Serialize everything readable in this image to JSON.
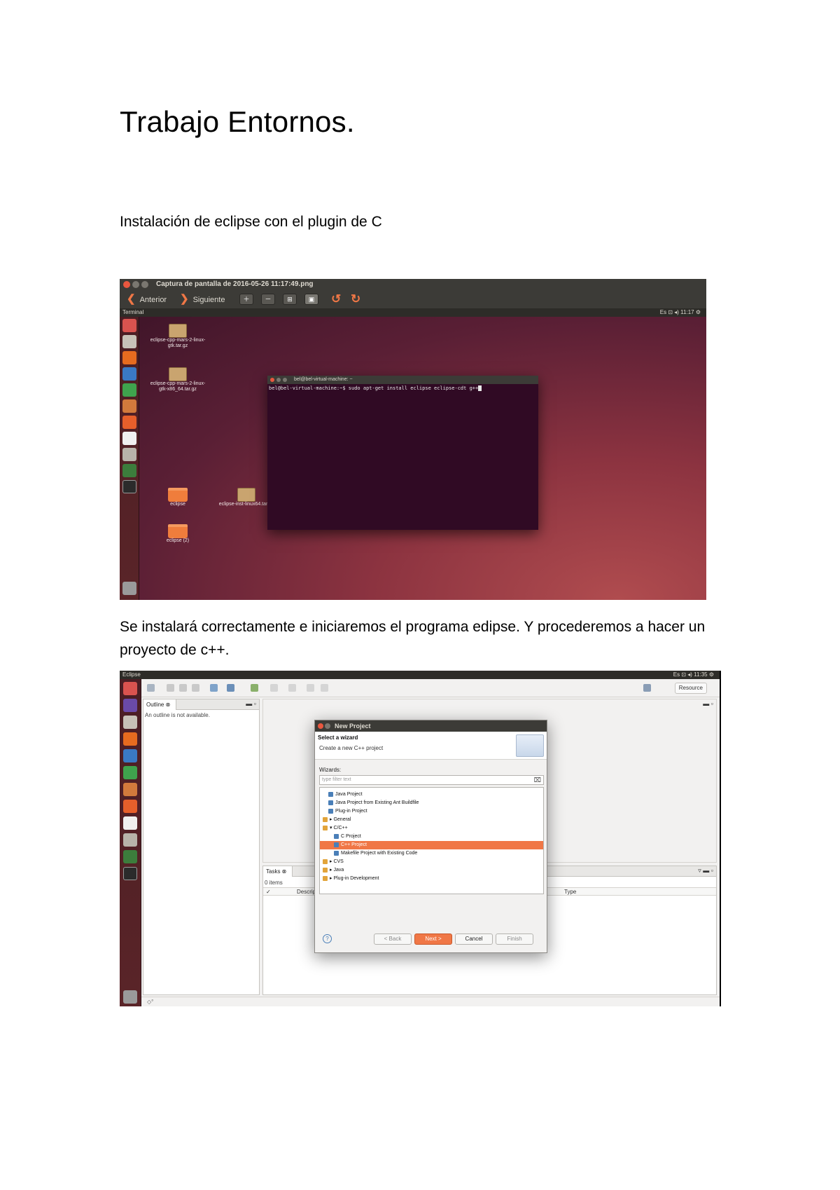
{
  "document": {
    "title": "Trabajo Entornos.",
    "subtitle": "Instalación de eclipse con el plugin de C",
    "paragraph": "Se instalará correctamente e iniciaremos el programa edipse. Y procederemos a hacer un proyecto de c++."
  },
  "screenshot1": {
    "window_title": "Captura de pantalla de 2016-05-26 11:17:49.png",
    "toolbar": {
      "back_label": "Anterior",
      "next_label": "Siguiente"
    },
    "panel_app": "Terminal",
    "panel_status": "Es  ⊡  ◂)  11:17  ⚙",
    "desktop_icons": [
      {
        "label": "eclipse-cpp-mars-2-linux-gtk.tar.gz"
      },
      {
        "label": "eclipse-cpp-mars-2-linux-gtk-x86_64.tar.gz"
      },
      {
        "label": "eclipse"
      },
      {
        "label": "eclipse-inst-linux64.tar.gz"
      },
      {
        "label": "eclipse (2)"
      }
    ],
    "terminal": {
      "title": "bel@bel-virtual-machine: ~",
      "command": "bel@bel-virtual-machine:~$ sudo apt-get install eclipse eclipse-cdt g++"
    }
  },
  "screenshot2": {
    "panel_app": "Eclipse",
    "panel_status": "Es  ⊡  ◂)  11:35  ⚙",
    "perspective_label": "Resource",
    "outline": {
      "tab_label": "Outline ⊗",
      "message": "An outline is not available."
    },
    "tasks": {
      "tab_label": "Tasks ⊗",
      "count": "0 items",
      "col_description": "Description",
      "col_type": "Type"
    },
    "dialog": {
      "title": "New Project",
      "header_title": "Select a wizard",
      "header_desc": "Create a new C++ project",
      "wizards_label": "Wizards:",
      "filter_placeholder": "type filter text",
      "tree_items": [
        {
          "label": "Java Project",
          "indent": 1,
          "selected": false
        },
        {
          "label": "Java Project from Existing Ant Buildfile",
          "indent": 1,
          "selected": false
        },
        {
          "label": "Plug-in Project",
          "indent": 1,
          "selected": false
        },
        {
          "label": "▸ General",
          "indent": 0,
          "selected": false
        },
        {
          "label": "▾ C/C++",
          "indent": 0,
          "selected": false
        },
        {
          "label": "C Project",
          "indent": 2,
          "selected": false
        },
        {
          "label": "C++ Project",
          "indent": 2,
          "selected": true
        },
        {
          "label": "Makefile Project with Existing Code",
          "indent": 2,
          "selected": false
        },
        {
          "label": "▸ CVS",
          "indent": 0,
          "selected": false
        },
        {
          "label": "▸ Java",
          "indent": 0,
          "selected": false
        },
        {
          "label": "▸ Plug-in Development",
          "indent": 0,
          "selected": false
        }
      ],
      "buttons": {
        "back": "< Back",
        "next": "Next >",
        "cancel": "Cancel",
        "finish": "Finish"
      }
    }
  },
  "colors": {
    "ubuntu_orange": "#f07746",
    "terminal_bg": "#300a24",
    "panel_dark": "#3c3b37"
  }
}
